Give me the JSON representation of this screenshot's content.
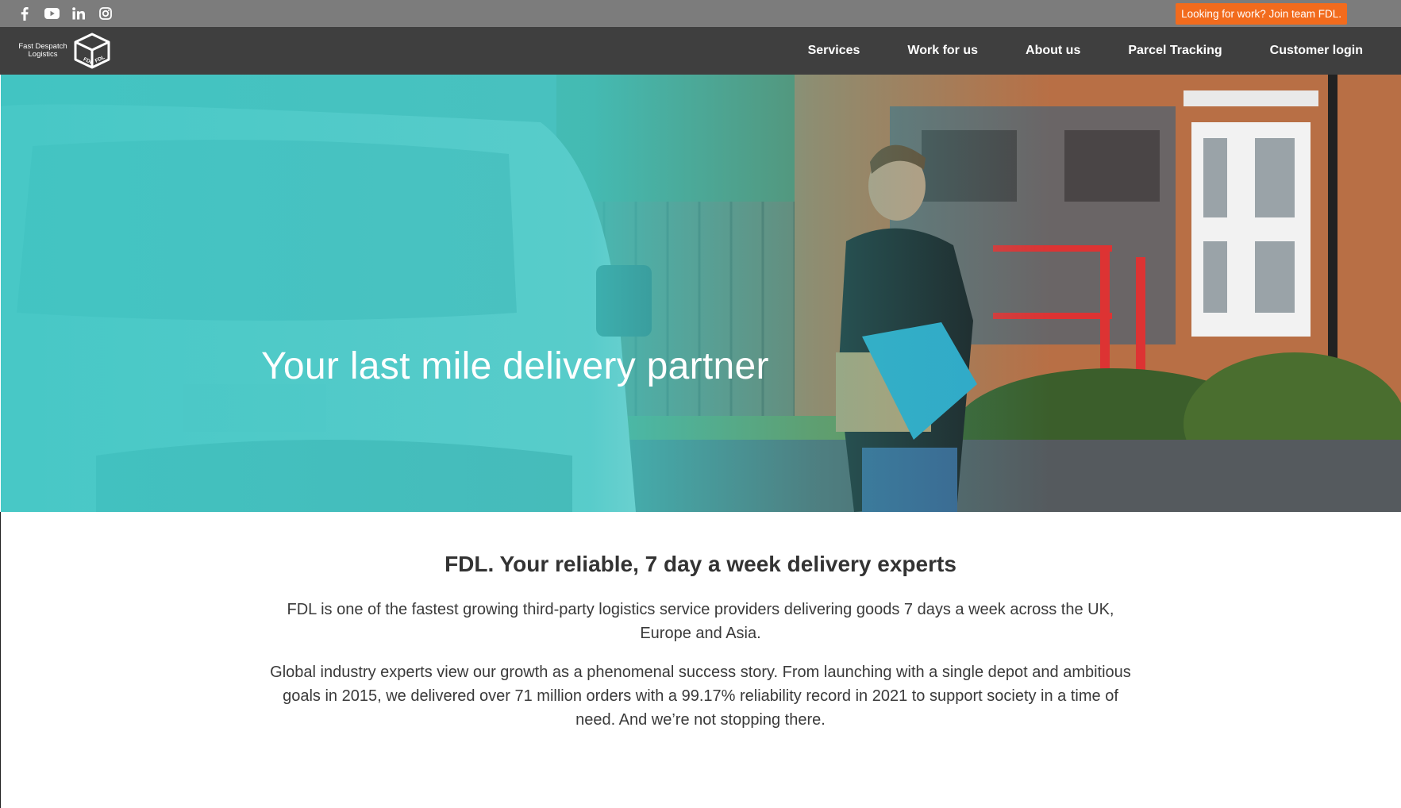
{
  "topbar": {
    "social": [
      {
        "icon": "facebook-icon"
      },
      {
        "icon": "youtube-icon"
      },
      {
        "icon": "linkedin-icon"
      },
      {
        "icon": "instagram-icon"
      }
    ],
    "cta_label": "Looking for work? Join team FDL.",
    "cta_color": "#f26b1d"
  },
  "navbar": {
    "logo_text_line1": "Fast Despatch",
    "logo_text_line2": "Logistics",
    "logo_box_text": "FDL",
    "items": [
      {
        "label": "Services"
      },
      {
        "label": "Work for us"
      },
      {
        "label": "About us"
      },
      {
        "label": "Parcel Tracking"
      },
      {
        "label": "Customer login"
      }
    ]
  },
  "hero": {
    "title": "Your last mile delivery partner",
    "overlay_color": "#3fc6c4"
  },
  "content": {
    "headline": "FDL. Your reliable, 7 day a week delivery experts",
    "paragraph1": "FDL is one of the fastest growing third-party logistics service providers delivering goods 7 days a week across the UK, Europe and Asia.",
    "paragraph2": "Global industry experts view our growth as a phenomenal success story. From launching with a single depot and ambitious goals in 2015, we delivered over 71 million orders with a 99.17% reliability record in 2021 to support society in a time of need. And we’re not stopping there."
  }
}
